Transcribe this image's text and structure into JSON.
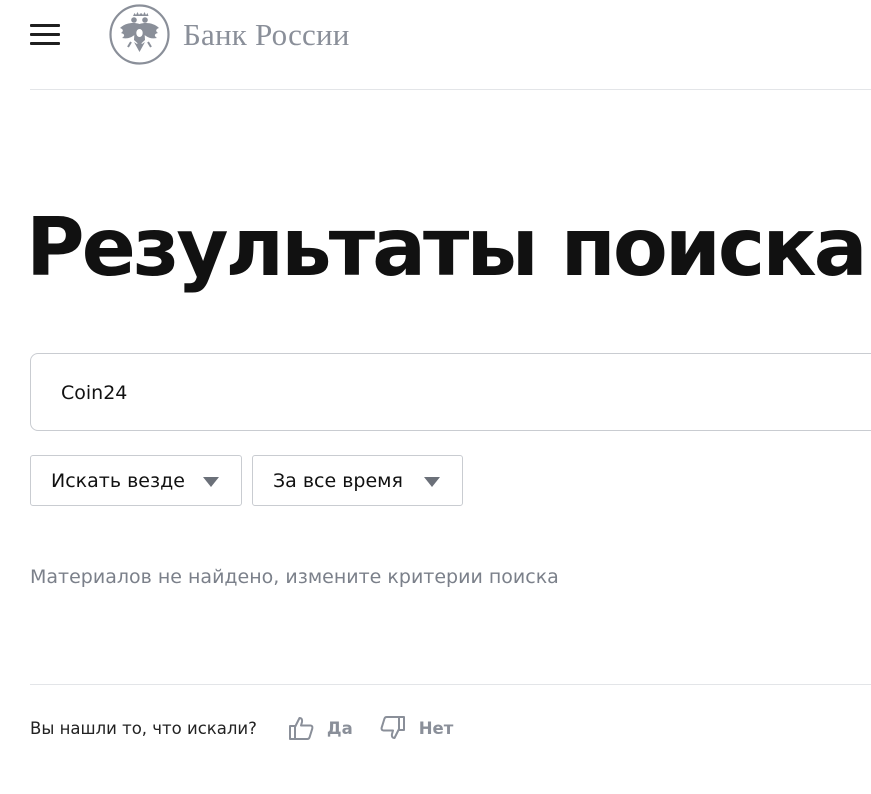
{
  "header": {
    "menu_icon": "hamburger-menu-icon",
    "logo_emblem": "double-headed-eagle-emblem",
    "logo_text": "Банк России"
  },
  "page": {
    "title": "Результаты поиска"
  },
  "search": {
    "value": "Coin24"
  },
  "filters": {
    "where": {
      "selected": "Искать везде",
      "icon": "triangle-down-icon"
    },
    "time": {
      "selected": "За все время",
      "icon": "triangle-down-icon"
    }
  },
  "results": {
    "message": "Материалов не найдено, измените критерии поиска"
  },
  "feedback": {
    "question": "Вы нашли то, что искали?",
    "yes_label": "Да",
    "yes_icon": "thumbs-up-icon",
    "no_label": "Нет",
    "no_icon": "thumbs-down-icon"
  },
  "colors": {
    "text_primary": "#111111",
    "text_muted": "#7b808a",
    "logo_gray": "#8a8f99",
    "border": "#c9ccd1",
    "divider": "#e3e5e8"
  }
}
